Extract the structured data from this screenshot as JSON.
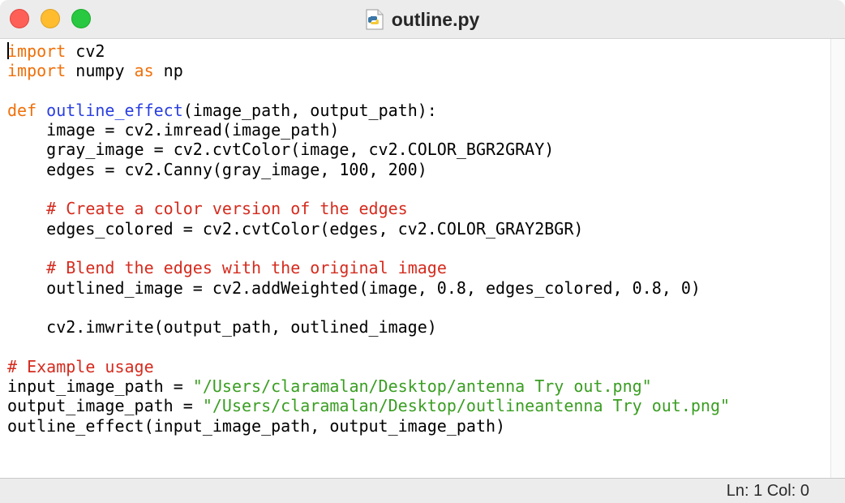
{
  "window": {
    "title": "outline.py",
    "file_icon": "python-file-icon"
  },
  "editor": {
    "lines": [
      [
        {
          "t": "import",
          "c": "kw-import"
        },
        {
          "t": " cv2",
          "c": ""
        }
      ],
      [
        {
          "t": "import",
          "c": "kw-import"
        },
        {
          "t": " numpy ",
          "c": ""
        },
        {
          "t": "as",
          "c": "kw-import"
        },
        {
          "t": " np",
          "c": ""
        }
      ],
      [],
      [
        {
          "t": "def",
          "c": "kw-def"
        },
        {
          "t": " ",
          "c": ""
        },
        {
          "t": "outline_effect",
          "c": "fn-name"
        },
        {
          "t": "(image_path, output_path):",
          "c": ""
        }
      ],
      [
        {
          "t": "    image = cv2.imread(image_path)",
          "c": ""
        }
      ],
      [
        {
          "t": "    gray_image = cv2.cvtColor(image, cv2.COLOR_BGR2GRAY)",
          "c": ""
        }
      ],
      [
        {
          "t": "    edges = cv2.Canny(gray_image, 100, 200)",
          "c": ""
        }
      ],
      [],
      [
        {
          "t": "    ",
          "c": ""
        },
        {
          "t": "# Create a color version of the edges",
          "c": "comment"
        }
      ],
      [
        {
          "t": "    edges_colored = cv2.cvtColor(edges, cv2.COLOR_GRAY2BGR)",
          "c": ""
        }
      ],
      [],
      [
        {
          "t": "    ",
          "c": ""
        },
        {
          "t": "# Blend the edges with the original image",
          "c": "comment"
        }
      ],
      [
        {
          "t": "    outlined_image = cv2.addWeighted(image, 0.8, edges_colored, 0.8, 0)",
          "c": ""
        }
      ],
      [],
      [
        {
          "t": "    cv2.imwrite(output_path, outlined_image)",
          "c": ""
        }
      ],
      [],
      [
        {
          "t": "# Example usage",
          "c": "comment"
        }
      ],
      [
        {
          "t": "input_image_path = ",
          "c": ""
        },
        {
          "t": "\"/Users/claramalan/Desktop/antenna Try out.png\"",
          "c": "string"
        }
      ],
      [
        {
          "t": "output_image_path = ",
          "c": ""
        },
        {
          "t": "\"/Users/claramalan/Desktop/outlineantenna Try out.png\"",
          "c": "string"
        }
      ],
      [
        {
          "t": "outline_effect(input_image_path, output_image_path)",
          "c": ""
        }
      ]
    ]
  },
  "status": {
    "position": "Ln: 1  Col: 0"
  },
  "colors": {
    "keyword": "#f0700a",
    "function_name": "#2a3fe0",
    "comment": "#d52b1e",
    "string": "#3a9e22",
    "close_button": "#fe5f57",
    "minimize_button": "#febc2e",
    "zoom_button": "#28c840"
  }
}
